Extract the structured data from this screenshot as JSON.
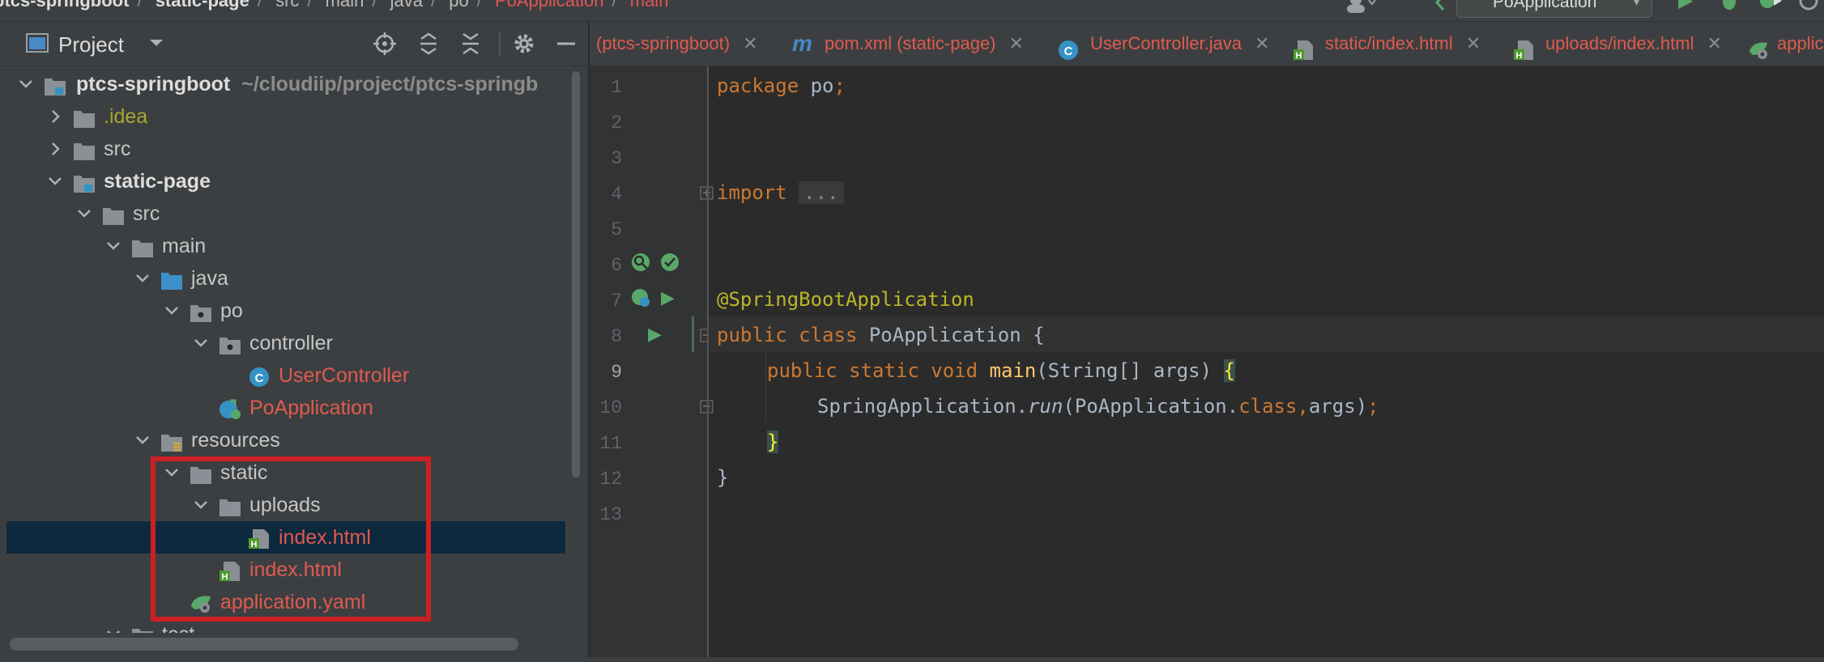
{
  "breadcrumb": {
    "items": [
      "ptcs-springboot",
      "static-page",
      "src",
      "main",
      "java",
      "po",
      "PoApplication",
      "main"
    ],
    "separator": "/",
    "run_config": "PoApplication"
  },
  "project_panel": {
    "title": "Project",
    "icons": [
      "locate-icon",
      "expand-all-icon",
      "collapse-all-icon",
      "gear-icon",
      "minimize-icon"
    ]
  },
  "tree": {
    "root": {
      "label": "ptcs-springboot",
      "path": "~/cloudiip/project/ptcs-springb"
    },
    "idea": ".idea",
    "src_root": "src",
    "static_page": "static-page",
    "src": "src",
    "main": "main",
    "java": "java",
    "po": "po",
    "controller": "controller",
    "user_controller": "UserController",
    "po_application": "PoApplication",
    "resources": "resources",
    "static": "static",
    "uploads": "uploads",
    "uploads_index": "index.html",
    "static_index": "index.html",
    "application_yaml": "application.yaml",
    "test": "test"
  },
  "tabs": [
    {
      "label": "(ptcs-springboot)"
    },
    {
      "label": "pom.xml (static-page)"
    },
    {
      "label": "UserController.java"
    },
    {
      "label": "static/index.html"
    },
    {
      "label": "uploads/index.html"
    },
    {
      "label": "applic"
    }
  ],
  "editor": {
    "line_numbers": [
      "1",
      "2",
      "3",
      "4",
      "5",
      "6",
      "7",
      "8",
      "9",
      "10",
      "11",
      "12",
      "13"
    ],
    "active_line": "9",
    "code": {
      "l1_kw": "package",
      "l1_rest": " po",
      "l1_semi": ";",
      "l4_kw": "import",
      "l4_fold": "...",
      "l7_ann": "@SpringBootApplication",
      "l8_kw": "public class",
      "l8_rest": " PoApplication {",
      "l9_kw": "public static void",
      "l9_fn": "main",
      "l9_rest": "(String[] args) ",
      "l9_brace": "{",
      "l10_a": "SpringApplication.",
      "l10_run": "run",
      "l10_b": "(PoApplication.",
      "l10_class": "class",
      "l10_comma": ",",
      "l10_c": "args)",
      "l10_semi": ";",
      "l11_brace": "}",
      "l12_brace": "}"
    }
  },
  "colors": {
    "highlight_box": "#cc1f24",
    "modified_file": "#e05a4f",
    "keyword": "#cc7832",
    "annotation": "#bbb529",
    "function": "#ffc66d"
  }
}
